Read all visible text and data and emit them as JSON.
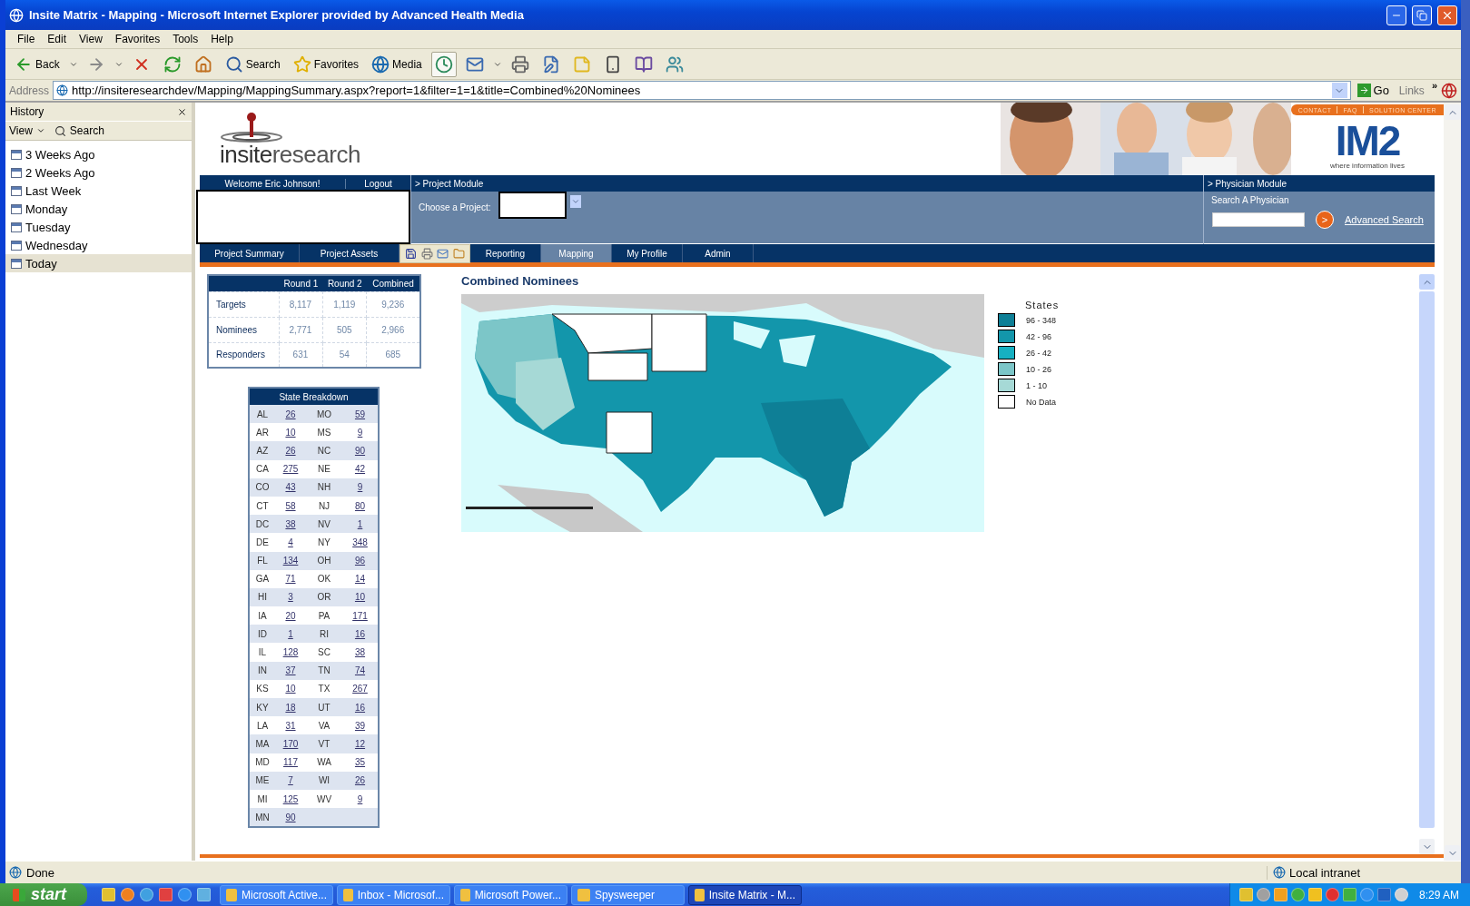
{
  "window": {
    "title": "Insite Matrix - Mapping - Microsoft Internet Explorer provided by Advanced Health Media"
  },
  "menu": [
    "File",
    "Edit",
    "View",
    "Favorites",
    "Tools",
    "Help"
  ],
  "toolbar": [
    {
      "kind": "back",
      "label": "Back",
      "dropdown": true
    },
    {
      "kind": "forward",
      "dropdown": true
    },
    {
      "kind": "stop"
    },
    {
      "kind": "refresh"
    },
    {
      "kind": "home"
    },
    {
      "kind": "search",
      "label": "Search"
    },
    {
      "kind": "favorites",
      "label": "Favorites"
    },
    {
      "kind": "media",
      "label": "Media"
    },
    {
      "kind": "history",
      "selected": true
    },
    {
      "kind": "mail",
      "dropdown": true
    },
    {
      "kind": "print"
    },
    {
      "kind": "edit"
    },
    {
      "kind": "note"
    },
    {
      "kind": "mobile"
    },
    {
      "kind": "research"
    },
    {
      "kind": "messenger"
    }
  ],
  "address": {
    "label": "Address",
    "url": "http://insiteresearchdev/Mapping/MappingSummary.aspx?report=1&filter=1=1&title=Combined%20Nominees",
    "go": "Go",
    "links": "Links",
    "more": "»"
  },
  "history": {
    "title": "History",
    "view": "View",
    "search": "Search",
    "items": [
      {
        "label": "3 Weeks Ago",
        "selected": false
      },
      {
        "label": "2 Weeks Ago",
        "selected": false
      },
      {
        "label": "Last Week",
        "selected": false
      },
      {
        "label": "Monday",
        "selected": false
      },
      {
        "label": "Tuesday",
        "selected": false
      },
      {
        "label": "Wednesday",
        "selected": false
      },
      {
        "label": "Today",
        "selected": true
      }
    ]
  },
  "site": {
    "logo_first": "insite",
    "logo_second": "research",
    "top_links": [
      "CONTACT",
      "FAQ",
      "SOLUTION CENTER"
    ],
    "brand": "IM2",
    "tagline": "where information lives",
    "welcome": "Welcome Eric Johnson!",
    "logout": "Logout",
    "project_module": "> Project Module",
    "choose_project": "Choose a Project:",
    "physician_module": "> Physician Module",
    "search_physician": "Search A Physician",
    "search_go": ">",
    "advanced_search": "Advanced Search"
  },
  "tabs": [
    {
      "label": "Project Summary",
      "selected": false
    },
    {
      "label": "Project Assets",
      "selected": false
    },
    {
      "kind": "tools"
    },
    {
      "label": "Reporting",
      "selected": false
    },
    {
      "label": "Mapping",
      "selected": true
    },
    {
      "label": "My Profile",
      "selected": false
    },
    {
      "label": "Admin",
      "selected": false
    }
  ],
  "stats": {
    "columns": [
      "Round 1",
      "Round 2",
      "Combined"
    ],
    "rows": [
      {
        "label": "Targets",
        "values": [
          "8,117",
          "1,119",
          "9,236"
        ]
      },
      {
        "label": "Nominees",
        "values": [
          "2,771",
          "505",
          "2,966"
        ]
      },
      {
        "label": "Responders",
        "values": [
          "631",
          "54",
          "685"
        ]
      }
    ]
  },
  "state_breakdown": {
    "title": "State Breakdown",
    "rows": [
      {
        "state": "AL",
        "count": "26",
        "state_2": "MO",
        "count_2": "59"
      },
      {
        "state": "AR",
        "count": "10",
        "state_2": "MS",
        "count_2": "9"
      },
      {
        "state": "AZ",
        "count": "26",
        "state_2": "NC",
        "count_2": "90"
      },
      {
        "state": "CA",
        "count": "275",
        "state_2": "NE",
        "count_2": "42"
      },
      {
        "state": "CO",
        "count": "43",
        "state_2": "NH",
        "count_2": "9"
      },
      {
        "state": "CT",
        "count": "58",
        "state_2": "NJ",
        "count_2": "80"
      },
      {
        "state": "DC",
        "count": "38",
        "state_2": "NV",
        "count_2": "1"
      },
      {
        "state": "DE",
        "count": "4",
        "state_2": "NY",
        "count_2": "348"
      },
      {
        "state": "FL",
        "count": "134",
        "state_2": "OH",
        "count_2": "96"
      },
      {
        "state": "GA",
        "count": "71",
        "state_2": "OK",
        "count_2": "14"
      },
      {
        "state": "HI",
        "count": "3",
        "state_2": "OR",
        "count_2": "10"
      },
      {
        "state": "IA",
        "count": "20",
        "state_2": "PA",
        "count_2": "171"
      },
      {
        "state": "ID",
        "count": "1",
        "state_2": "RI",
        "count_2": "16"
      },
      {
        "state": "IL",
        "count": "128",
        "state_2": "SC",
        "count_2": "38"
      },
      {
        "state": "IN",
        "count": "37",
        "state_2": "TN",
        "count_2": "74"
      },
      {
        "state": "KS",
        "count": "10",
        "state_2": "TX",
        "count_2": "267"
      },
      {
        "state": "KY",
        "count": "18",
        "state_2": "UT",
        "count_2": "16"
      },
      {
        "state": "LA",
        "count": "31",
        "state_2": "VA",
        "count_2": "39"
      },
      {
        "state": "MA",
        "count": "170",
        "state_2": "VT",
        "count_2": "12"
      },
      {
        "state": "MD",
        "count": "117",
        "state_2": "WA",
        "count_2": "35"
      },
      {
        "state": "ME",
        "count": "7",
        "state_2": "WI",
        "count_2": "26"
      },
      {
        "state": "MI",
        "count": "125",
        "state_2": "WV",
        "count_2": "9"
      },
      {
        "state": "MN",
        "count": "90"
      }
    ]
  },
  "map": {
    "title": "Combined Nominees",
    "kind": "picture"
  },
  "legend": {
    "title": "States",
    "items": [
      {
        "label": "96 - 348",
        "color": "#0e7f96"
      },
      {
        "label": "42 - 96",
        "color": "#1396ab"
      },
      {
        "label": "26 - 42",
        "color": "#16b0c2"
      },
      {
        "label": "10 - 26",
        "color": "#7cc6c8"
      },
      {
        "label": "1 - 10",
        "color": "#a6d9d6"
      },
      {
        "label": "No Data",
        "color": "#ffffff"
      }
    ]
  },
  "status_bar": {
    "text": "Done",
    "zone": "Local intranet"
  },
  "taskbar": {
    "start": "start",
    "tasks": [
      {
        "label": "Microsoft Active...",
        "selected": false
      },
      {
        "label": "Inbox - Microsof...",
        "selected": false
      },
      {
        "label": "Microsoft Power...",
        "selected": false
      },
      {
        "label": "Spysweeper",
        "selected": false
      },
      {
        "label": "Insite Matrix - M...",
        "selected": true
      }
    ],
    "clock": "8:29 AM"
  }
}
